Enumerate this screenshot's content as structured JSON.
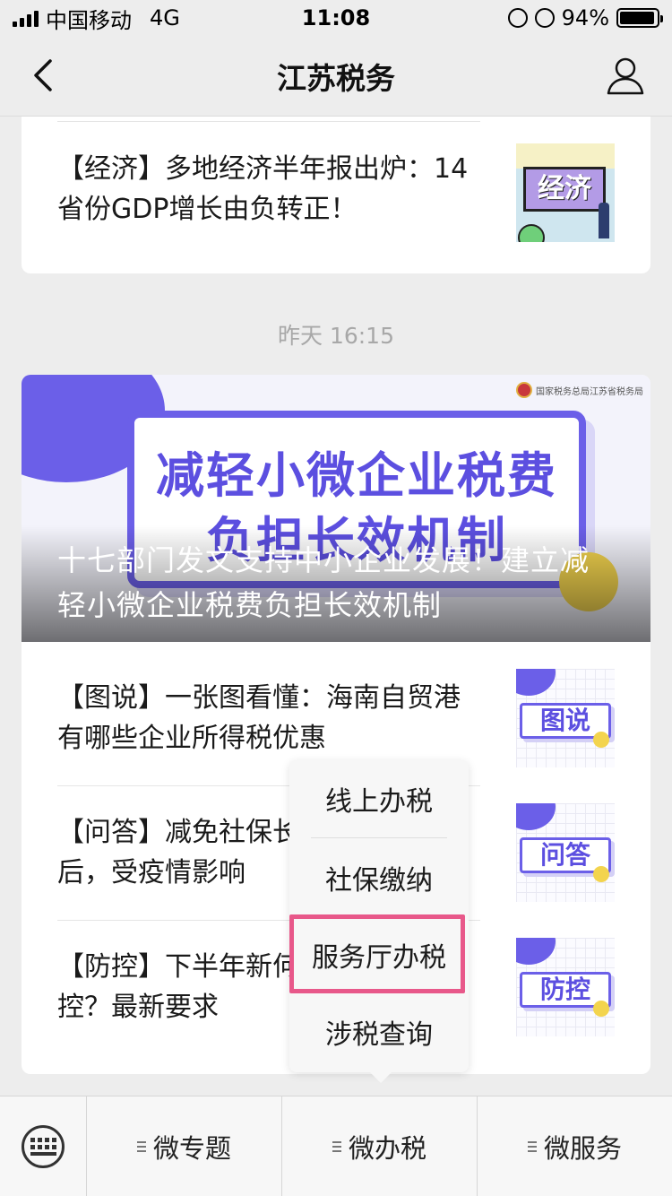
{
  "status_bar": {
    "carrier": "中国移动",
    "network": "4G",
    "time": "11:08",
    "battery": "94%",
    "battery_level": 0.94
  },
  "header": {
    "title": "江苏税务",
    "back_icon": "chevron-left-icon",
    "profile_icon": "person-icon"
  },
  "top_article": {
    "title": "【经济】多地经济半年报出炉：14省份GDP增长由负转正！",
    "thumb_label": "经济"
  },
  "timestamp": "昨天 16:15",
  "main_article": {
    "banner_text_line1": "减轻小微企业税费",
    "banner_text_line2": "负担长效机制",
    "seal_text": "国家税务总局江苏省税务局",
    "title": "十七部门发文支持中小企业发展！建立减轻小微企业税费负担长效机制"
  },
  "articles": [
    {
      "title": "【图说】一张图看懂：海南自贸港有哪些企业所得税优惠",
      "thumb_label": "图说"
    },
    {
      "title": "【问答】减免社保长后，受疫情影响",
      "thumb_label": "问答"
    },
    {
      "title": "【防控】下半年新何防控？最新要求",
      "thumb_label": "防控"
    }
  ],
  "popup_menu": {
    "items": [
      "线上办税",
      "社保缴纳",
      "服务厅办税",
      "涉税查询"
    ],
    "highlighted": "服务厅办税"
  },
  "bottom_menu": {
    "keyboard_icon": "keyboard-icon",
    "items": [
      "微专题",
      "微办税",
      "微服务"
    ]
  },
  "colors": {
    "accent_purple": "#6b5fe8",
    "highlight_pink": "#e8588a",
    "background": "#ededed"
  }
}
